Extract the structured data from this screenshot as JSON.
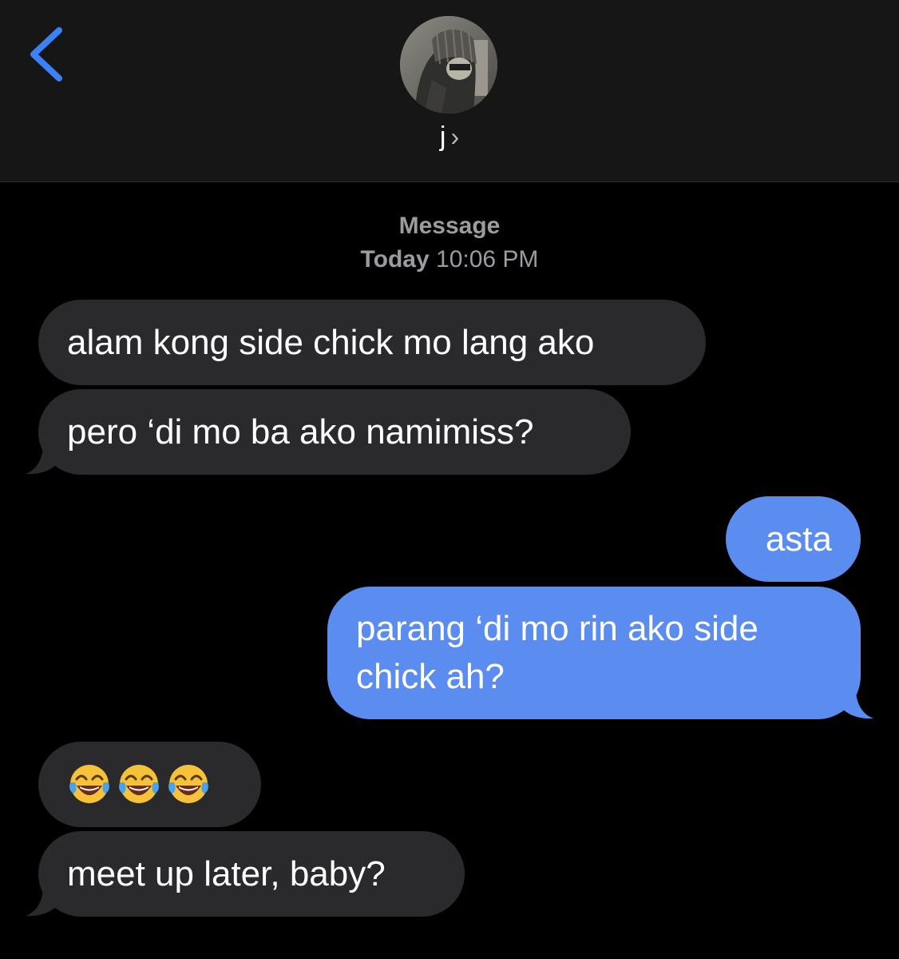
{
  "header": {
    "contact_name": "j",
    "chevron": "›"
  },
  "meta": {
    "service": "Message",
    "day": "Today",
    "time": "10:06 PM"
  },
  "messages": [
    {
      "side": "incoming",
      "text": "alam kong side chick mo lang ako"
    },
    {
      "side": "incoming",
      "text": "pero ‘di mo ba ako namimiss?"
    },
    {
      "side": "outgoing",
      "text": "asta"
    },
    {
      "side": "outgoing",
      "text_line1": "parang ‘di mo rin ako side",
      "text_line2": "chick ah?"
    },
    {
      "side": "incoming",
      "emoji": "face-with-tears-of-joy",
      "emoji_count": 3
    },
    {
      "side": "incoming",
      "text": "meet up later, baby?"
    }
  ],
  "colors": {
    "background": "#000000",
    "header": "#161616",
    "incoming_bubble": "#2a2a2c",
    "outgoing_bubble": "#5b8cf0",
    "accent": "#3b82f6",
    "meta_text": "#9b9ba0"
  },
  "icons": {
    "back": "chevron-left-icon",
    "avatar": "contact-avatar"
  }
}
